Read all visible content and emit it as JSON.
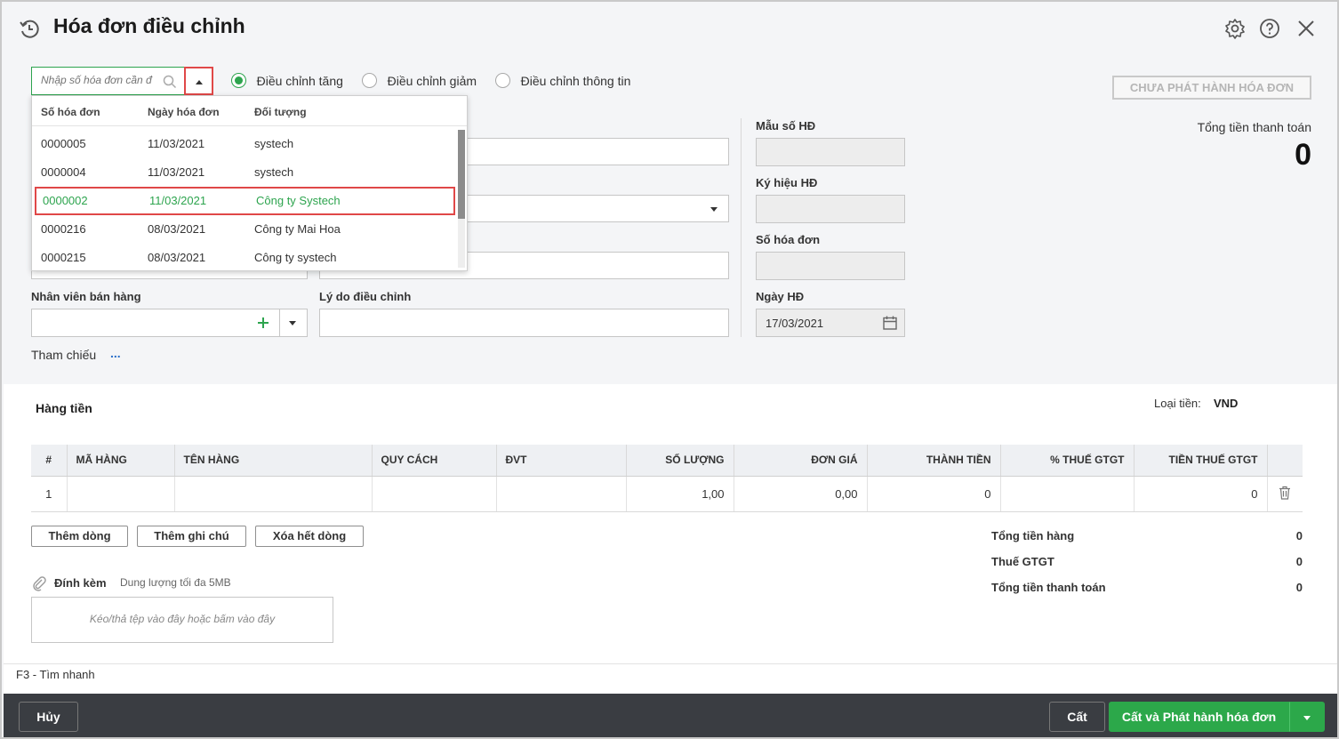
{
  "header": {
    "title": "Hóa đơn điều chỉnh"
  },
  "search": {
    "placeholder": "Nhập số hóa đơn cần đ"
  },
  "adjust_options": [
    {
      "label": "Điều chỉnh tăng",
      "checked": true
    },
    {
      "label": "Điều chỉnh giảm",
      "checked": false
    },
    {
      "label": "Điều chỉnh thông tin",
      "checked": false
    }
  ],
  "dropdown": {
    "columns": [
      "Số hóa đơn",
      "Ngày hóa đơn",
      "Đối tượng"
    ],
    "rows": [
      {
        "so": "0000005",
        "ngay": "11/03/2021",
        "doi_tuong": "systech"
      },
      {
        "so": "0000004",
        "ngay": "11/03/2021",
        "doi_tuong": "systech"
      },
      {
        "so": "0000002",
        "ngay": "11/03/2021",
        "doi_tuong": "Công ty Systech"
      },
      {
        "so": "0000216",
        "ngay": "08/03/2021",
        "doi_tuong": "Công ty Mai Hoa"
      },
      {
        "so": "0000215",
        "ngay": "08/03/2021",
        "doi_tuong": "Công ty systech"
      }
    ]
  },
  "status_button": "CHƯA PHÁT HÀNH HÓA ĐƠN",
  "payment_total": {
    "label": "Tổng tiền thanh toán",
    "value": "0"
  },
  "form": {
    "nhan_vien_label": "Nhân viên bán hàng",
    "ly_do_label": "Lý do điều chỉnh",
    "tham_chieu_label": "Tham chiếu",
    "tham_chieu_more": "...",
    "mau_so_label": "Mẫu số HĐ",
    "ky_hieu_label": "Ký hiệu HĐ",
    "so_hoa_don_label": "Số hóa đơn",
    "ngay_hd_label": "Ngày HĐ",
    "ngay_hd_value": "17/03/2021"
  },
  "goods": {
    "section_title": "Hàng tiền",
    "currency_label": "Loại tiền:",
    "currency_value": "VND",
    "columns": [
      "#",
      "MÃ HÀNG",
      "TÊN HÀNG",
      "QUY CÁCH",
      "ĐVT",
      "SỐ LƯỢNG",
      "ĐƠN GIÁ",
      "THÀNH TIỀN",
      "% THUẾ GTGT",
      "TIỀN THUẾ GTGT"
    ],
    "rows": [
      {
        "stt": "1",
        "ma": "",
        "ten": "",
        "quy_cach": "",
        "dvt": "",
        "so_luong": "1,00",
        "don_gia": "0,00",
        "thanh_tien": "0",
        "thue_pct": "",
        "tien_thue": "0"
      }
    ],
    "buttons": {
      "add_row": "Thêm dòng",
      "add_note": "Thêm ghi chú",
      "clear_rows": "Xóa hết dòng"
    }
  },
  "attachment": {
    "label": "Đính kèm",
    "limit": "Dung lượng tối đa 5MB",
    "drop_hint": "Kéo/thả tệp vào đây hoặc bấm vào đây"
  },
  "totals": [
    {
      "label": "Tổng tiền hàng",
      "value": "0"
    },
    {
      "label": "Thuế GTGT",
      "value": "0"
    },
    {
      "label": "Tổng tiền thanh toán",
      "value": "0"
    }
  ],
  "shortcut_hint": "F3 - Tìm nhanh",
  "footer": {
    "cancel": "Hủy",
    "save": "Cất",
    "save_publish": "Cất và Phát hành hóa đơn"
  },
  "colors": {
    "accent": "#2ca84a",
    "highlight": "#e04848",
    "footer_bg": "#3a3d42"
  }
}
